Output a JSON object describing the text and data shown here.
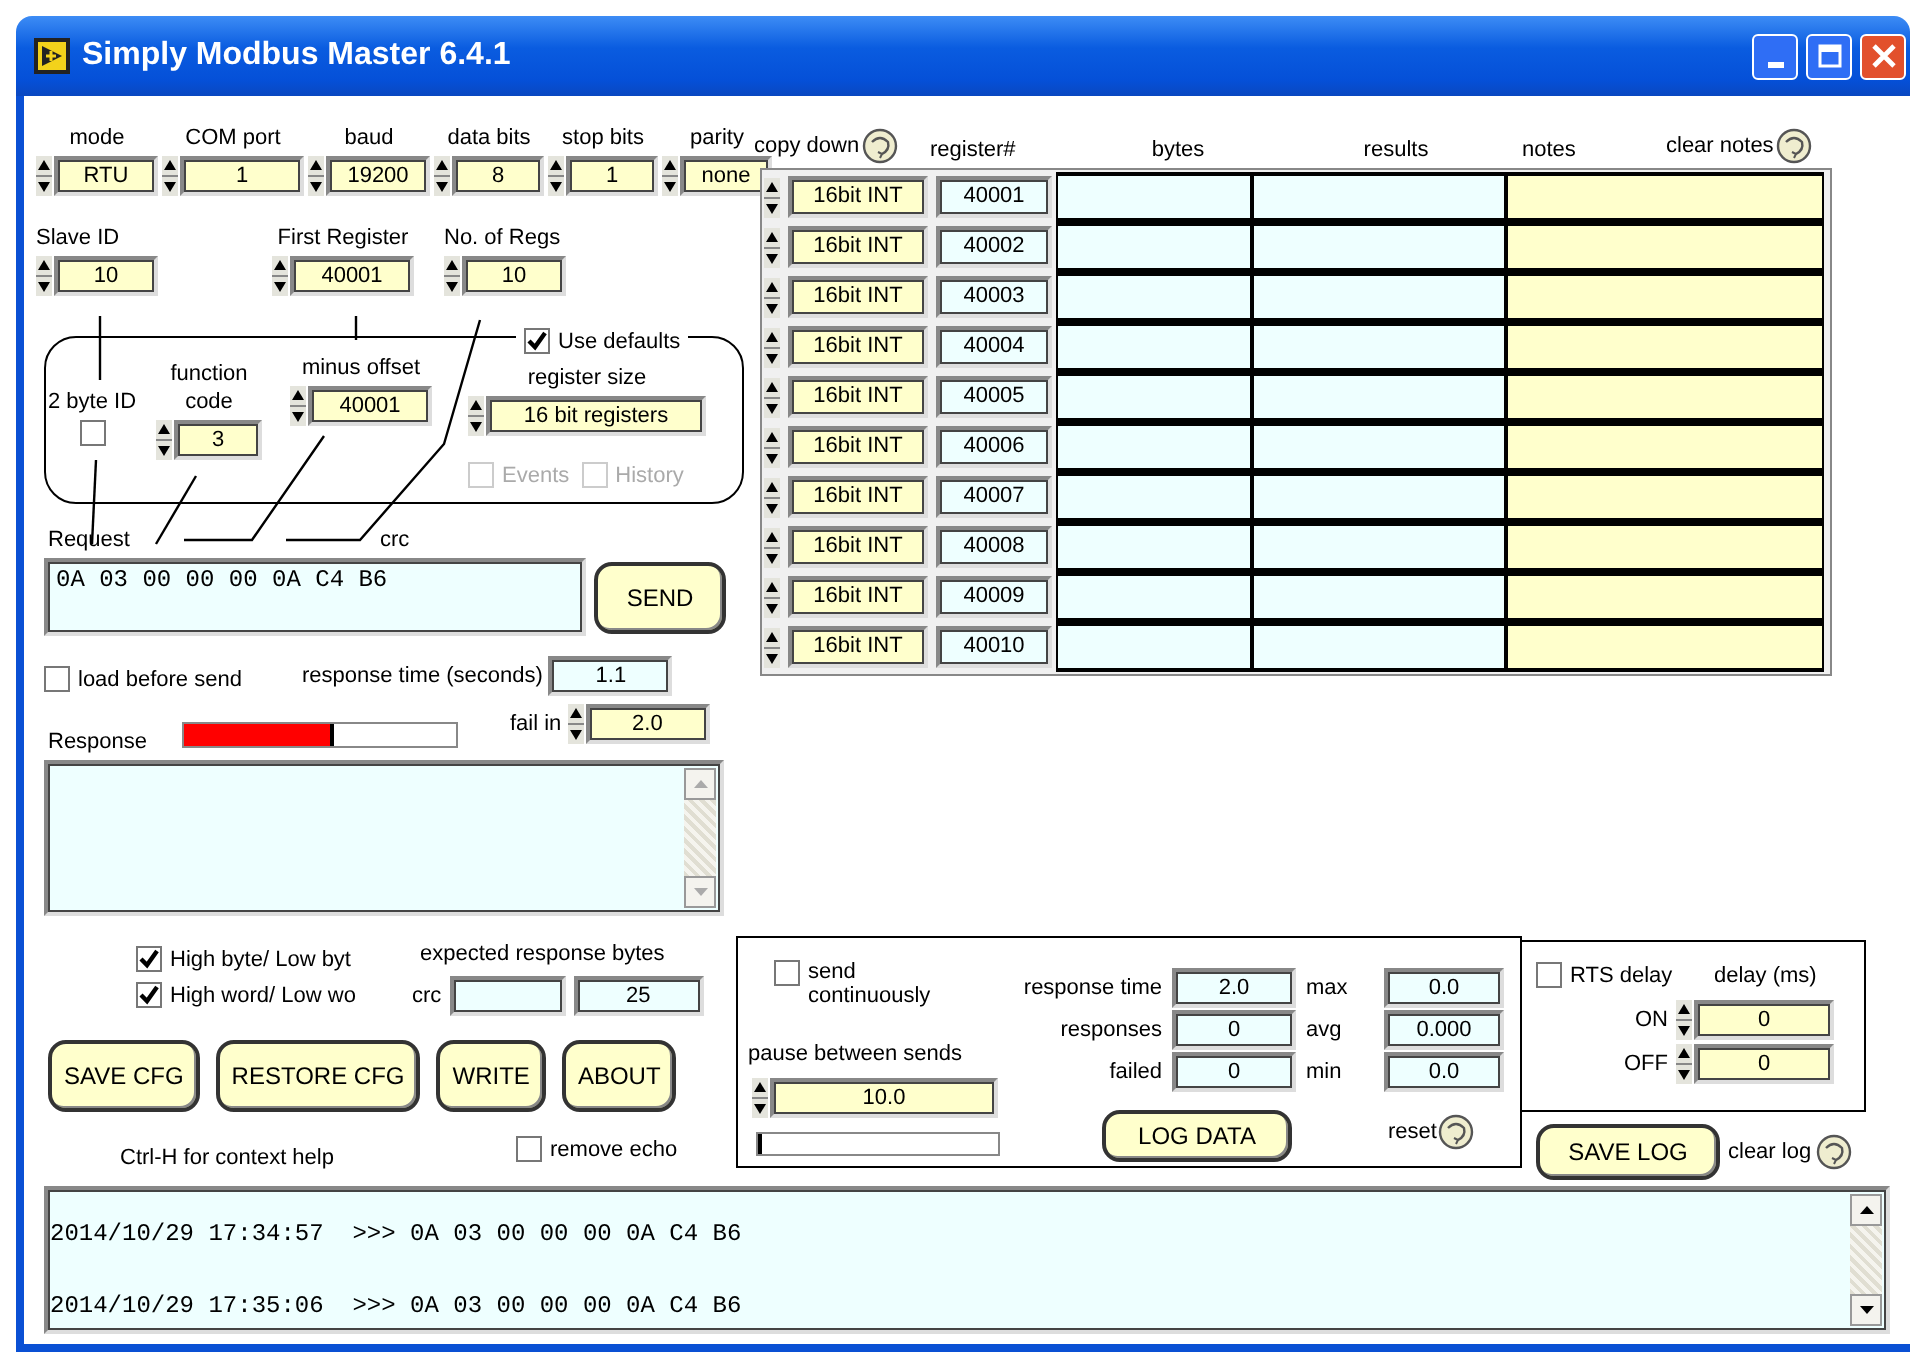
{
  "window": {
    "title": "Simply Modbus Master 6.4.1"
  },
  "connection": [
    {
      "label": "mode",
      "value": "RTU"
    },
    {
      "label": "COM port",
      "value": "1"
    },
    {
      "label": "baud",
      "value": "19200"
    },
    {
      "label": "data bits",
      "value": "8"
    },
    {
      "label": "stop bits",
      "value": "1"
    },
    {
      "label": "parity",
      "value": "none"
    }
  ],
  "slave_id": {
    "label": "Slave ID",
    "value": "10"
  },
  "first_register": {
    "label": "First Register",
    "value": "40001"
  },
  "no_of_regs": {
    "label": "No. of Regs",
    "value": "10"
  },
  "defaults_group": {
    "use_defaults": {
      "label": "Use defaults",
      "checked": true
    },
    "two_byte_id": {
      "label": "2 byte ID",
      "checked": false
    },
    "function_code": {
      "label": "function code",
      "value": "3"
    },
    "minus_offset": {
      "label": "minus offset",
      "value": "40001"
    },
    "register_size": {
      "label": "register size",
      "value": "16 bit registers"
    },
    "events": {
      "label": "Events",
      "checked": false,
      "disabled": true
    },
    "history": {
      "label": "History",
      "checked": false,
      "disabled": true
    }
  },
  "request": {
    "label": "Request",
    "crc_label": "crc",
    "value": "0A 03 00 00 00 0A C4 B6",
    "send_button": "SEND"
  },
  "load_before_send": {
    "label": "load before send",
    "checked": false
  },
  "response_time": {
    "label": "response time (seconds)",
    "value": "1.1"
  },
  "response": {
    "label": "Response",
    "level": 0.55
  },
  "fail_in": {
    "label": "fail in",
    "value": "2.0"
  },
  "byte_order": [
    {
      "label": "High byte/ Low byt",
      "checked": true
    },
    {
      "label": "High word/ Low wo",
      "checked": true
    }
  ],
  "expected_response_bytes": {
    "label": "expected response bytes",
    "crc_label": "crc",
    "value": "25"
  },
  "buttons": [
    "SAVE CFG",
    "RESTORE CFG",
    "WRITE",
    "ABOUT"
  ],
  "help_text": "Ctrl-H for context help",
  "remove_echo": {
    "label": "remove echo",
    "checked": false
  },
  "polling": {
    "send_continuously": {
      "label": "send continuously",
      "checked": false
    },
    "pause": {
      "label": "pause between sends",
      "value": "10.0",
      "level": 0
    },
    "stats": [
      {
        "label": "response time",
        "value": "2.0"
      },
      {
        "label": "responses",
        "value": "0"
      },
      {
        "label": "failed",
        "value": "0"
      }
    ],
    "extremes": [
      {
        "label": "max",
        "value": "0.0"
      },
      {
        "label": "avg",
        "value": "0.000"
      },
      {
        "label": "min",
        "value": "0.0"
      }
    ],
    "log_data_button": "LOG DATA",
    "reset_label": "reset"
  },
  "rts": {
    "label": "RTS delay",
    "checked": false,
    "delay_label": "delay (ms)",
    "on": {
      "label": "ON",
      "value": "0"
    },
    "off": {
      "label": "OFF",
      "value": "0"
    }
  },
  "save_log_button": "SAVE LOG",
  "clear_log_label": "clear log",
  "log": {
    "lines": [
      "2014/10/29 17:34:57  >>> 0A 03 00 00 00 0A C4 B6",
      "2014/10/29 17:35:06  >>> 0A 03 00 00 00 0A C4 B6"
    ]
  },
  "table": {
    "copy_down_label": "copy down",
    "columns": [
      "register#",
      "bytes",
      "results",
      "notes"
    ],
    "clear_notes_label": "clear notes",
    "rows": [
      {
        "type": "16bit INT",
        "register": "40001"
      },
      {
        "type": "16bit INT",
        "register": "40002"
      },
      {
        "type": "16bit INT",
        "register": "40003"
      },
      {
        "type": "16bit INT",
        "register": "40004"
      },
      {
        "type": "16bit INT",
        "register": "40005"
      },
      {
        "type": "16bit INT",
        "register": "40006"
      },
      {
        "type": "16bit INT",
        "register": "40007"
      },
      {
        "type": "16bit INT",
        "register": "40008"
      },
      {
        "type": "16bit INT",
        "register": "40009"
      },
      {
        "type": "16bit INT",
        "register": "40010"
      }
    ]
  }
}
